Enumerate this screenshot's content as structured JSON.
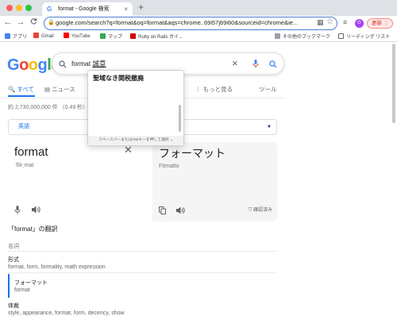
{
  "window": {
    "tab_title": "format - Google 検索",
    "new_tab": "+",
    "tab_close": "×"
  },
  "toolbar": {
    "back": "←",
    "forward": "→",
    "reload": "C",
    "url": "google.com/search?q=format&oq=format&aqs=chrome..69i57j69i60&sourceid=chrome&ie...",
    "avatar_initial": "G",
    "update_label": "更新 ⋮"
  },
  "bookmarks": {
    "items": [
      {
        "label": "アプリ",
        "color": "#4285f4"
      },
      {
        "label": "Gmail",
        "color": "#ea4335"
      },
      {
        "label": "YouTube",
        "color": "#ff0000"
      },
      {
        "label": "マップ",
        "color": "#34a853"
      },
      {
        "label": "Ruby on Rails ガイ...",
        "color": "#cc0000"
      }
    ],
    "other": "その他のブックマーク",
    "reading_list": "リーディング リスト"
  },
  "search": {
    "logo": "Google",
    "query_plain": "format ",
    "query_composing": "誠意",
    "tabs": [
      "すべて",
      "ニュース",
      "⋮ もっと見る",
      "ツール"
    ],
    "stats": "約 2,730,000,000 件 （0.49 秒）"
  },
  "ime": {
    "candidate": "聖域なき関税撤廃",
    "hint": "スペースバーまたはTabキーを押して選択"
  },
  "translate": {
    "source_lang": "英語",
    "source_word": "format",
    "source_phonetic": "ˈfôrˌmat",
    "target_word": "フォーマット",
    "target_romaji": "Fōmatto",
    "verified": "確認済み",
    "section_title": "「format」の翻訳",
    "groups": [
      {
        "pos": "名詞",
        "entries": [
          {
            "word": "形式",
            "synonyms": "format, form, formality, math expression"
          },
          {
            "word": "フォーマット",
            "synonyms": "format"
          }
        ]
      },
      {
        "pos": "",
        "entries": [
          {
            "word": "体裁",
            "synonyms": "style, appearance, format, form, decency, show"
          }
        ]
      }
    ]
  }
}
